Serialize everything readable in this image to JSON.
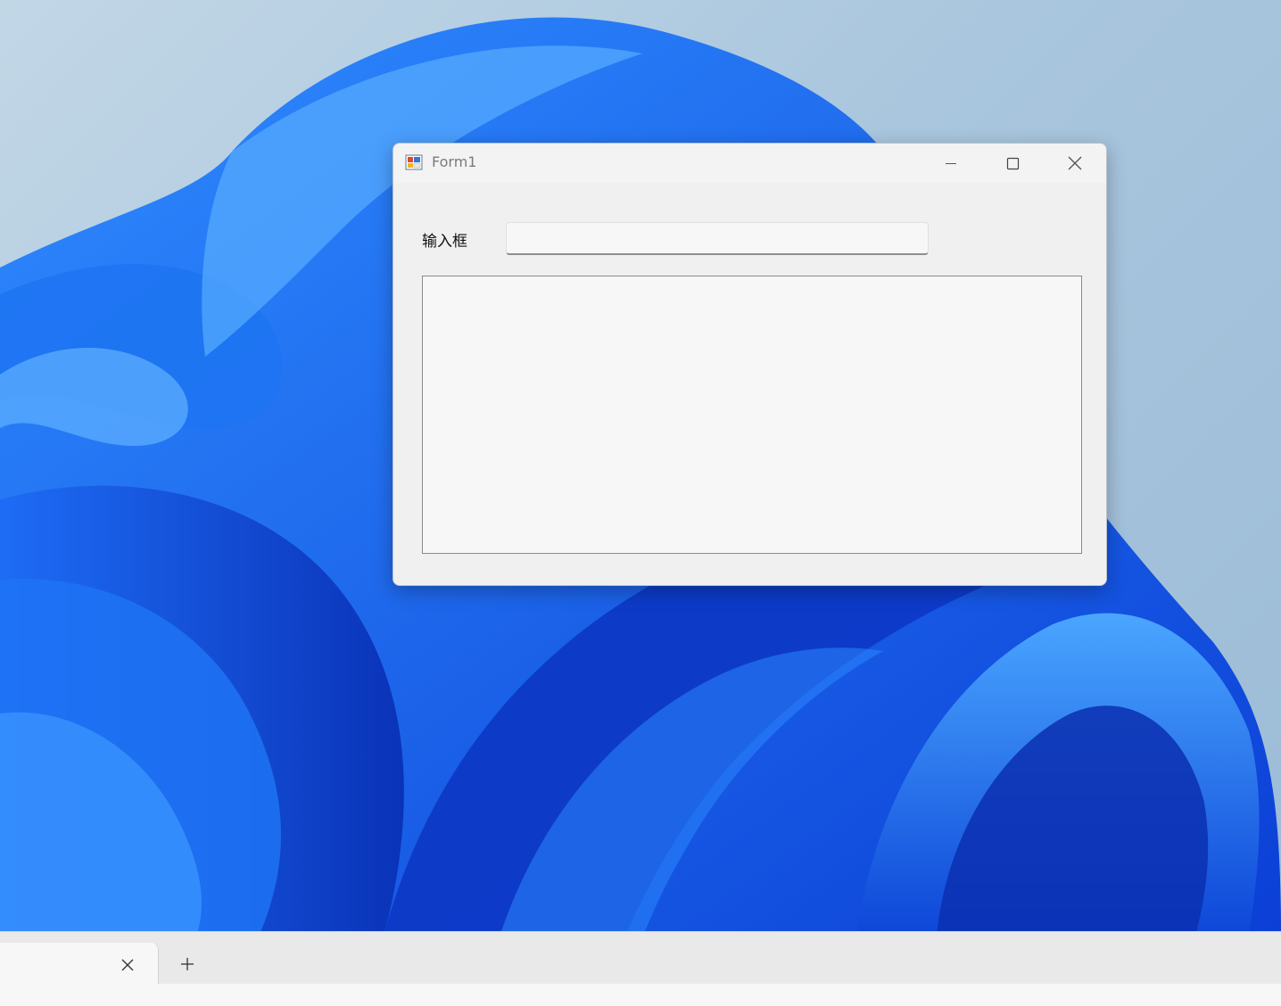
{
  "window": {
    "title": "Form1",
    "icon": "winforms-app-icon",
    "controls": {
      "minimize_icon": "minimize-icon",
      "maximize_icon": "maximize-icon",
      "close_icon": "close-icon"
    }
  },
  "form": {
    "input_label": "输入框",
    "input_value": "",
    "textarea_value": ""
  },
  "tabbar": {
    "tab_close_icon": "close-icon",
    "new_tab_icon": "plus-icon"
  },
  "colors": {
    "wallpaper_blue": "#1a5ce6",
    "window_bg": "#f0f0f0",
    "title_text": "#7b7b7b"
  }
}
